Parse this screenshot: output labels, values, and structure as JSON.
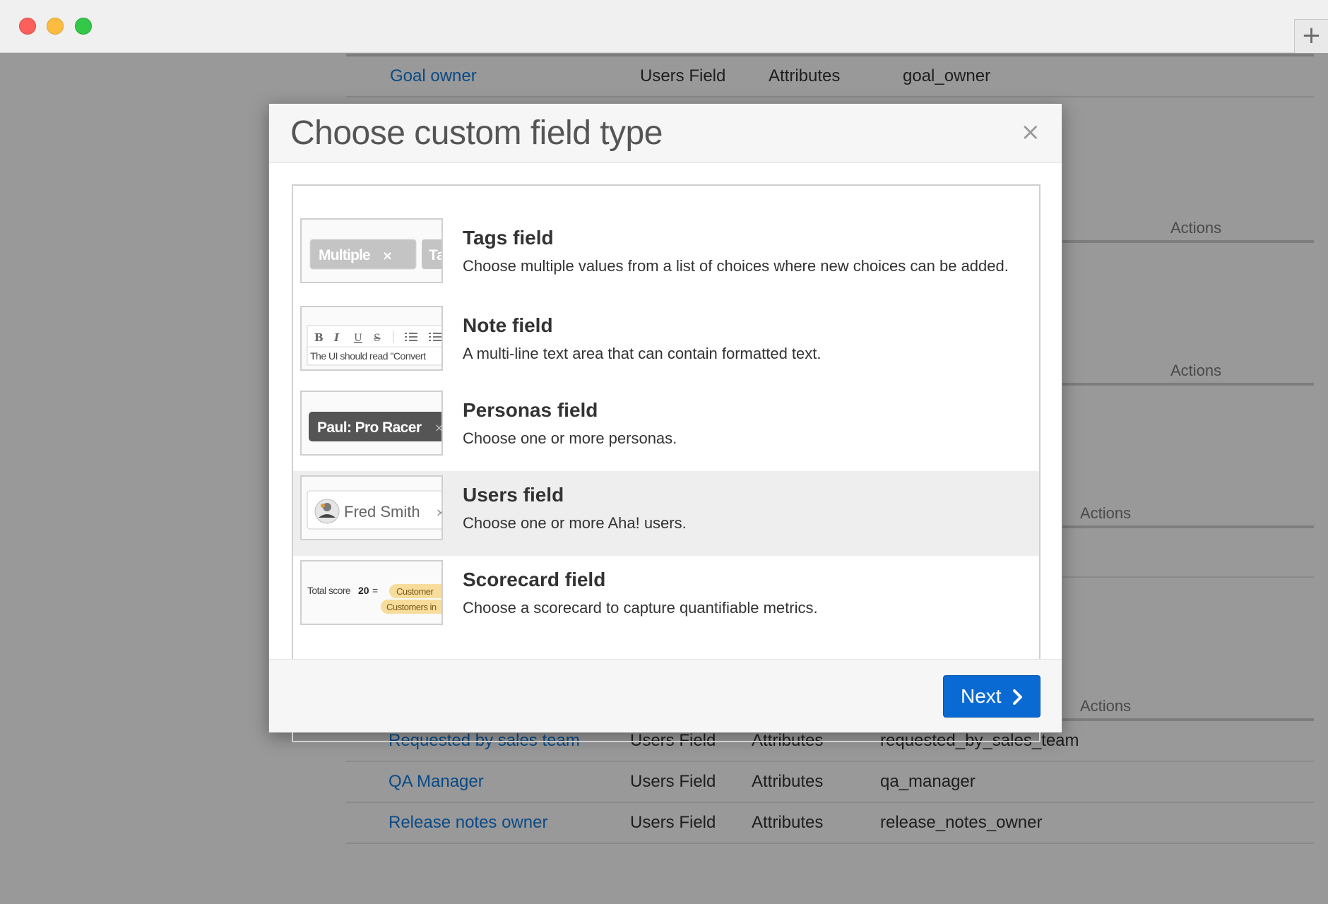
{
  "window": {
    "new_tab_glyph": "+"
  },
  "background_table": {
    "top_row": {
      "name": "Goal owner",
      "type": "Users Field",
      "category": "Attributes",
      "key": "goal_owner"
    },
    "actions_labels": [
      "Actions",
      "Actions",
      "Actions",
      "Actions"
    ],
    "bottom_rows": [
      {
        "name": "Requested by sales team",
        "type": "Users Field",
        "category": "Attributes",
        "key": "requested_by_sales_team"
      },
      {
        "name": "QA Manager",
        "type": "Users Field",
        "category": "Attributes",
        "key": "qa_manager"
      },
      {
        "name": "Release notes owner",
        "type": "Users Field",
        "category": "Attributes",
        "key": "release_notes_owner"
      }
    ]
  },
  "modal": {
    "title": "Choose custom field type",
    "close_glyph": "×",
    "items": [
      {
        "title": "Tags field",
        "description": "Choose multiple values from a list of choices where new choices can be added.",
        "preview": {
          "chip1": "Multiple",
          "chip1_x": "×",
          "chip2": "Ta"
        }
      },
      {
        "title": "Note field",
        "description": "A multi-line text area that can contain formatted text.",
        "preview": {
          "toolbar": [
            "B",
            "I",
            "U",
            "S"
          ],
          "text": "The UI should read \"Convert"
        }
      },
      {
        "title": "Personas field",
        "description": "Choose one or more personas.",
        "preview": {
          "chip": "Paul: Pro Racer",
          "chip_x": "×"
        }
      },
      {
        "title": "Users field",
        "description": "Choose one or more Aha! users.",
        "preview": {
          "chip": "Fred Smith",
          "chip_x": "×"
        }
      },
      {
        "title": "Scorecard field",
        "description": "Choose a scorecard to capture quantifiable metrics.",
        "preview": {
          "label": "Total score",
          "score": "20",
          "eq": "=",
          "tag1": "Customer",
          "tag2": "Customers in"
        }
      }
    ],
    "selected_index": 3,
    "next_label": "Next"
  },
  "colors": {
    "accent": "#0a6ad3",
    "link": "#0b4a86",
    "overlay": "#999999",
    "selected_row": "#eeeeee"
  }
}
